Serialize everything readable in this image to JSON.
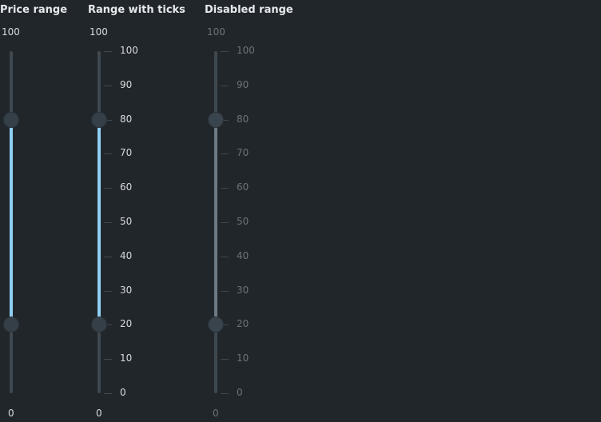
{
  "sliders": [
    {
      "title": "Price range",
      "max_label": "100",
      "min_label": "0",
      "min": 0,
      "max": 100,
      "low": 20,
      "high": 80,
      "show_ticks": false,
      "disabled": false
    },
    {
      "title": "Range with ticks",
      "max_label": "100",
      "min_label": "0",
      "min": 0,
      "max": 100,
      "low": 20,
      "high": 80,
      "show_ticks": true,
      "disabled": false
    },
    {
      "title": "Disabled range",
      "max_label": "100",
      "min_label": "0",
      "min": 0,
      "max": 100,
      "low": 20,
      "high": 80,
      "show_ticks": true,
      "disabled": true
    }
  ],
  "tick_labels": [
    "100",
    "90",
    "80",
    "70",
    "60",
    "50",
    "40",
    "30",
    "20",
    "10",
    "0"
  ],
  "colors": {
    "active_fill": "#8fcff3",
    "disabled_fill": "#6d7a83",
    "rail": "#3e4850",
    "background": "#21262b"
  }
}
